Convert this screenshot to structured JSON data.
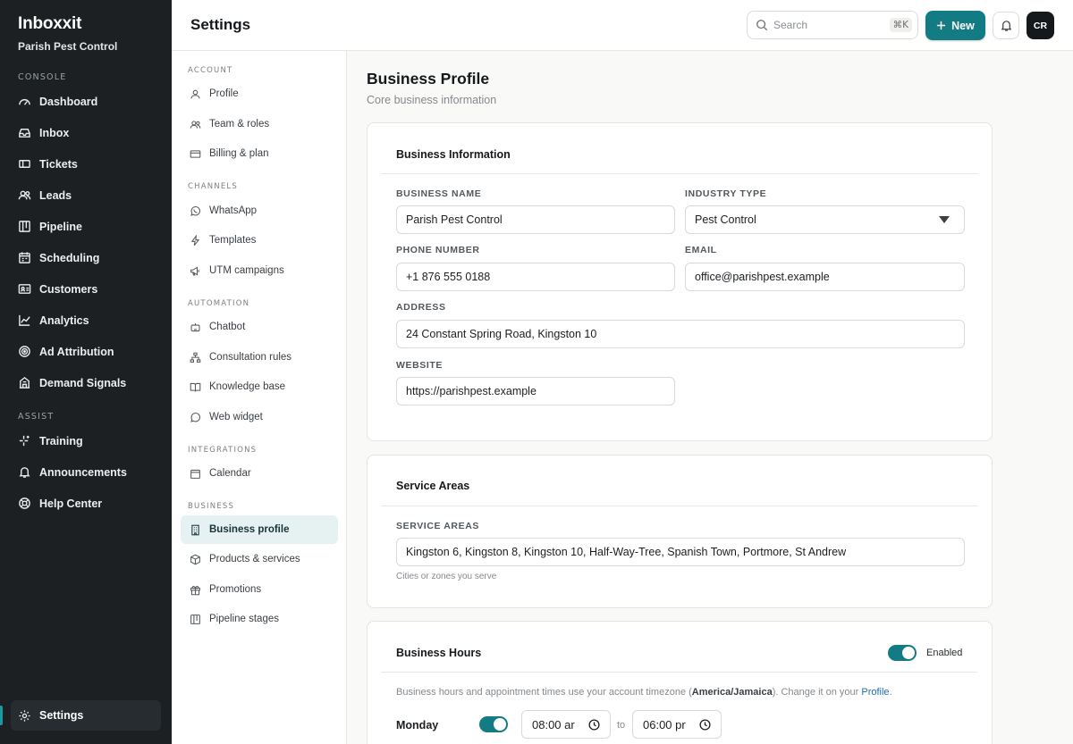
{
  "app": {
    "brand": "Inboxxit",
    "org": "Parish Pest Control"
  },
  "sidebar": {
    "console_label": "CONSOLE",
    "console_items": [
      {
        "label": "Dashboard",
        "icon": "dashboard-icon"
      },
      {
        "label": "Inbox",
        "icon": "inbox-icon"
      },
      {
        "label": "Tickets",
        "icon": "ticket-icon"
      },
      {
        "label": "Leads",
        "icon": "users-icon"
      },
      {
        "label": "Pipeline",
        "icon": "pipeline-icon"
      },
      {
        "label": "Scheduling",
        "icon": "calendar-icon"
      },
      {
        "label": "Customers",
        "icon": "id-card-icon"
      },
      {
        "label": "Analytics",
        "icon": "chart-line-icon"
      },
      {
        "label": "Ad Attribution",
        "icon": "target-icon"
      },
      {
        "label": "Demand Signals",
        "icon": "building-icon"
      }
    ],
    "assist_label": "ASSIST",
    "assist_items": [
      {
        "label": "Training",
        "icon": "sparkle-icon"
      },
      {
        "label": "Announcements",
        "icon": "bell-icon"
      },
      {
        "label": "Help Center",
        "icon": "lifebuoy-icon"
      }
    ],
    "settings_label": "Settings"
  },
  "header": {
    "title": "Settings",
    "search_placeholder": "Search",
    "search_shortcut": "⌘K",
    "new_label": "New",
    "avatar_initials": "CR"
  },
  "subnav": {
    "account_label": "ACCOUNT",
    "account": [
      "Profile",
      "Team & roles",
      "Billing & plan"
    ],
    "channels_label": "CHANNELS",
    "channels": [
      "WhatsApp",
      "Templates",
      "UTM campaigns"
    ],
    "automation_label": "AUTOMATION",
    "automation": [
      "Chatbot",
      "Consultation rules",
      "Knowledge base",
      "Web widget"
    ],
    "integrations_label": "INTEGRATIONS",
    "integrations": [
      "Calendar"
    ],
    "business_label": "BUSINESS",
    "business": [
      "Business profile",
      "Products & services",
      "Promotions",
      "Pipeline stages"
    ]
  },
  "main": {
    "title": "Business Profile",
    "subtitle": "Core business information",
    "info_card": {
      "heading": "Business Information",
      "business_name_label": "BUSINESS NAME",
      "business_name": "Parish Pest Control",
      "industry_label": "INDUSTRY TYPE",
      "industry": "Pest Control",
      "phone_label": "PHONE NUMBER",
      "phone": "+1 876 555 0188",
      "email_label": "EMAIL",
      "email": "office@parishpest.example",
      "address_label": "ADDRESS",
      "address": "24 Constant Spring Road, Kingston 10",
      "website_label": "WEBSITE",
      "website": "https://parishpest.example"
    },
    "areas_card": {
      "heading": "Service Areas",
      "label": "SERVICE AREAS",
      "value": "Kingston 6, Kingston 8, Kingston 10, Half-Way-Tree, Spanish Town, Portmore, St Andrew",
      "hint": "Cities or zones you serve"
    },
    "hours_card": {
      "heading": "Business Hours",
      "enabled_label": "Enabled",
      "enabled": true,
      "note_prefix": "Business hours and appointment times use your account timezone (",
      "timezone": "America/Jamaica",
      "note_suffix": "). Change it on your ",
      "note_link": "Profile",
      "note_end": ".",
      "monday_label": "Monday",
      "monday_open": "08:00 ar",
      "to_label": "to",
      "monday_close": "06:00 pr"
    }
  },
  "colors": {
    "accent": "#137b83",
    "sidebar_bg": "#1c2023",
    "active_bg": "#e6f2f1",
    "link": "#1e6fb8"
  }
}
